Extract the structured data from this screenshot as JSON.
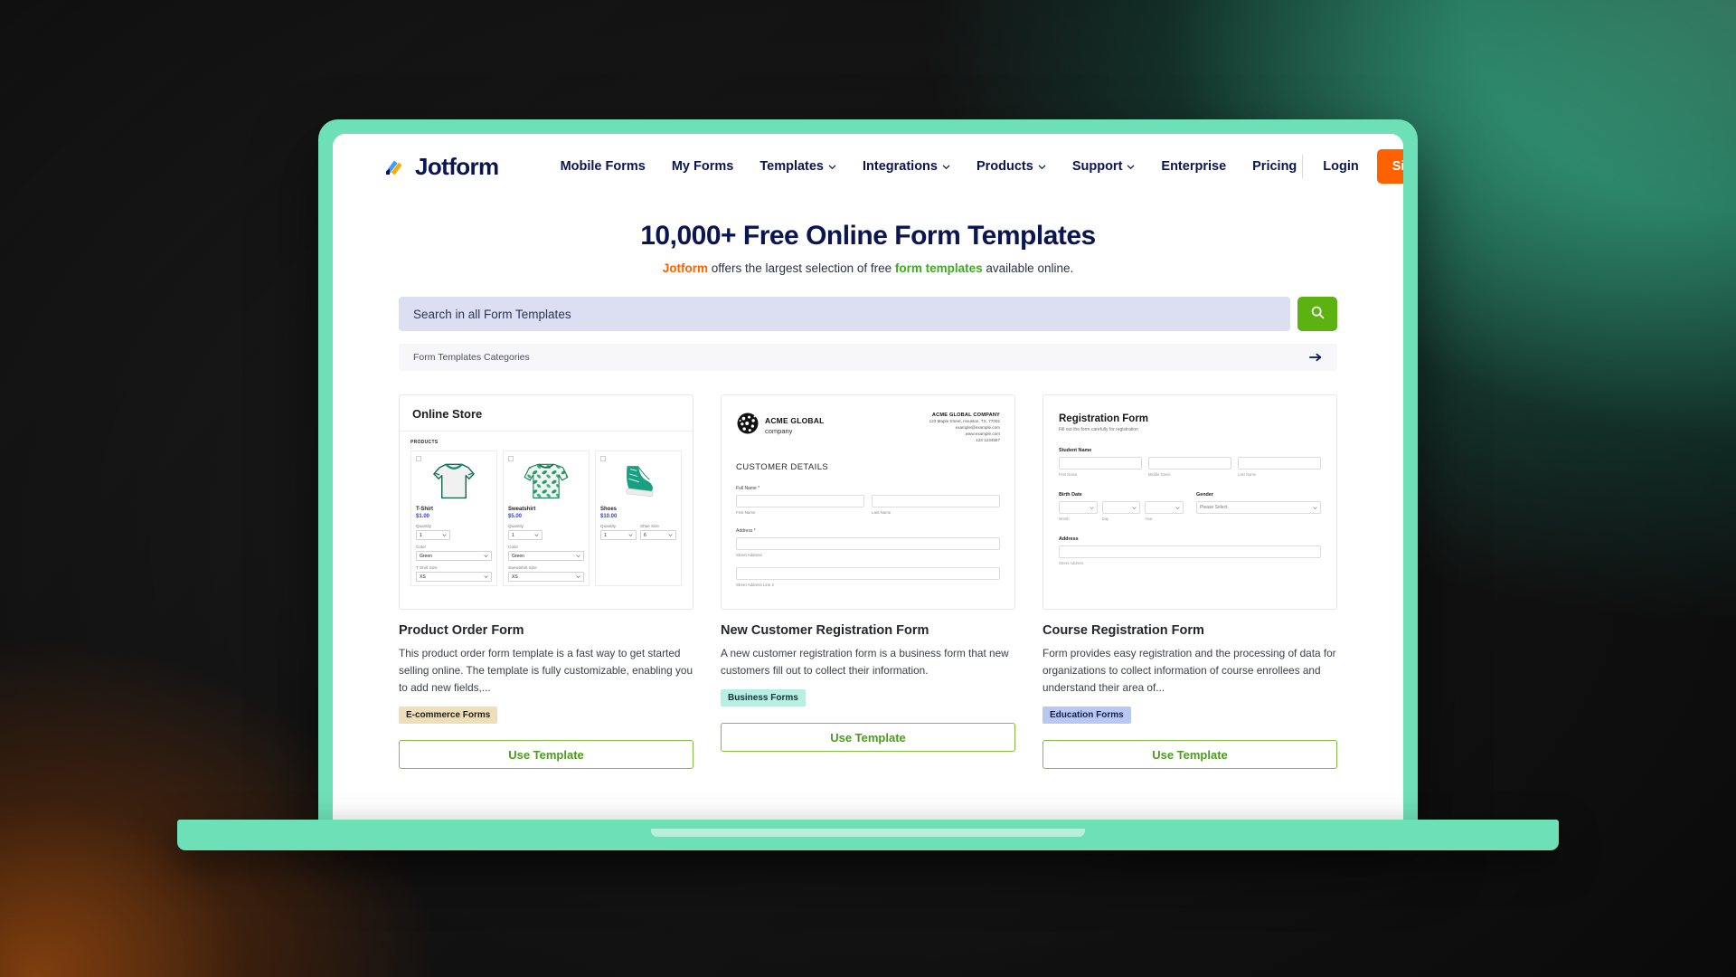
{
  "brand": {
    "name": "Jotform",
    "logo_colors": {
      "blue": "#0a1551",
      "orange": "#ffa800",
      "light_blue": "#3d9cf5"
    }
  },
  "nav": {
    "links": [
      {
        "label": "Mobile Forms",
        "has_caret": false
      },
      {
        "label": "My Forms",
        "has_caret": false
      },
      {
        "label": "Templates",
        "has_caret": true
      },
      {
        "label": "Integrations",
        "has_caret": true
      },
      {
        "label": "Products",
        "has_caret": true
      },
      {
        "label": "Support",
        "has_caret": true
      },
      {
        "label": "Enterprise",
        "has_caret": false
      },
      {
        "label": "Pricing",
        "has_caret": false
      }
    ],
    "login_label": "Login",
    "signup_label": "Sign Up for Free",
    "signup_color": "#ff6100"
  },
  "hero": {
    "title": "10,000+ Free Online Form Templates",
    "subtitle_pre": "",
    "subtitle_brand": "Jotform",
    "subtitle_mid": " offers the largest selection of free ",
    "subtitle_link": "form templates",
    "subtitle_post": " available online."
  },
  "search": {
    "placeholder": "Search in all Form Templates",
    "value": "",
    "button_icon": "search-icon",
    "button_color": "#5bb211"
  },
  "categories_bar": {
    "label": "Form Templates Categories",
    "arrow_icon": "arrow-right-icon"
  },
  "cards": [
    {
      "title": "Product Order Form",
      "description": "This product order form template is a fast way to get started selling online. The template is fully customizable, enabling you to add new fields,...",
      "tag": "E-commerce Forms",
      "tag_bg": "#efdfb8",
      "tag_color": "#1f1f1f",
      "button_label": "Use Template",
      "preview": {
        "kind": "online-store",
        "header": "Online Store",
        "products_label": "PRODUCTS",
        "products": [
          {
            "name": "T-Shirt",
            "price": "$1.00",
            "fields": [
              {
                "label": "Quantity",
                "value": "1",
                "narrow": true
              },
              {
                "label": "Color",
                "value": "Green",
                "narrow": false
              },
              {
                "label": "T Shirt Size",
                "value": "XS",
                "narrow": false
              }
            ]
          },
          {
            "name": "Sweatshirt",
            "price": "$5.00",
            "fields": [
              {
                "label": "Quantity",
                "value": "1",
                "narrow": true
              },
              {
                "label": "Color",
                "value": "Green",
                "narrow": false
              },
              {
                "label": "Sweatshirt Size",
                "value": "XS",
                "narrow": false
              }
            ]
          },
          {
            "name": "Shoes",
            "price": "$10.00",
            "fields": [
              {
                "label": "Quantity",
                "value": "1",
                "narrow": true
              },
              {
                "label": "Shoe Size",
                "value": "6",
                "narrow": true
              }
            ]
          }
        ]
      }
    },
    {
      "title": "New Customer Registration Form",
      "description": "A new customer registration form is a business form that new customers fill out to collect their information.",
      "tag": "Business Forms",
      "tag_bg": "#b9eee3",
      "tag_color": "#10313a",
      "button_label": "Use Template",
      "preview": {
        "kind": "customer-details",
        "company_name": "ACME GLOBAL",
        "company_sub": "company",
        "address_title": "ACME GLOBAL COMPANY",
        "address_lines": [
          "123 Maple Street, Houston, TX, 77002",
          "example@example.com",
          "www.example.com",
          "123 1234567"
        ],
        "section_title": "CUSTOMER DETAILS",
        "fields": [
          {
            "label": "Full Name *",
            "sublabels": [
              "First Name",
              "Last Name"
            ]
          },
          {
            "label": "Address *",
            "sublabels": [
              "Street Address"
            ]
          },
          {
            "label": "",
            "sublabels": [
              "Street Address Line 2"
            ]
          }
        ]
      }
    },
    {
      "title": "Course Registration Form",
      "description": "Form provides easy registration and the processing of data for organizations to collect information of course enrollees and understand their area of...",
      "tag": "Education Forms",
      "tag_bg": "#b9c8f2",
      "tag_color": "#15204a",
      "button_label": "Use Template",
      "preview": {
        "kind": "registration-form",
        "title": "Registration Form",
        "subtitle": "Fill out the form carefully for registration",
        "student_name_label": "Student Name",
        "student_name_hints": [
          "First Name",
          "Middle Name",
          "Last Name"
        ],
        "birth_date_label": "Birth Date",
        "birth_date_hints": [
          "Month",
          "Day",
          "Year"
        ],
        "gender_label": "Gender",
        "gender_value": "Please Select",
        "address_label": "Address",
        "address_hint": "Street Address"
      }
    }
  ]
}
